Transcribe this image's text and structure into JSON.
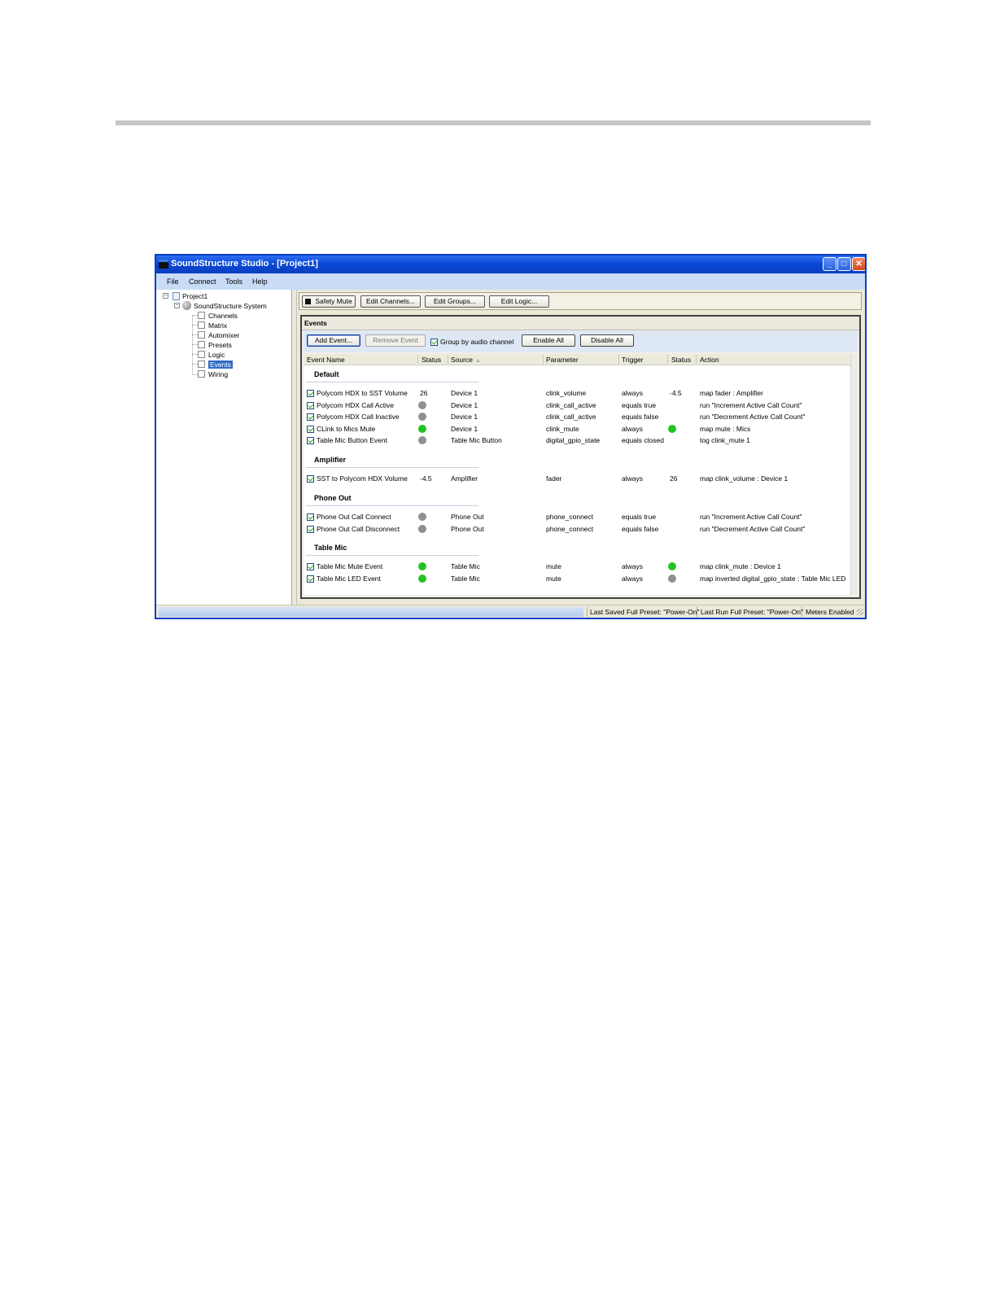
{
  "window": {
    "title": "SoundStructure Studio - [Project1]",
    "controls": {
      "minimize": "_",
      "maximize": "□",
      "close": "✕"
    }
  },
  "menu": [
    "File",
    "Connect",
    "Tools",
    "Help"
  ],
  "tree": {
    "project": "Project1",
    "system": "SoundStructure System",
    "items": [
      "Channels",
      "Matrix",
      "Automixer",
      "Presets",
      "Logic",
      "Events",
      "Wiring"
    ],
    "selected": "Events"
  },
  "toolbar": {
    "safety_mute": "Safety Mute",
    "edit_channels": "Edit Channels...",
    "edit_groups": "Edit Groups...",
    "edit_logic": "Edit Logic..."
  },
  "events": {
    "panel_title": "Events",
    "add_event": "Add Event...",
    "remove_event": "Remove Event",
    "group_by": "Group by audio channel",
    "group_by_checked": true,
    "enable_all": "Enable All",
    "disable_all": "Disable All",
    "columns": [
      "Event Name",
      "Status",
      "Source",
      "Parameter",
      "Trigger",
      "Status",
      "Action"
    ],
    "groups": [
      {
        "title": "Default",
        "rows": [
          {
            "name": "Polycom HDX to SST Volume",
            "status": "26",
            "source": "Device 1",
            "parameter": "clink_volume",
            "trigger": "always",
            "status2": "-4.5",
            "action": "map fader : Amplifier"
          },
          {
            "name": "Polycom HDX Call Active",
            "status": "gray",
            "source": "Device 1",
            "parameter": "clink_call_active",
            "trigger": "equals true",
            "status2": "",
            "action": "run \"Increment Active Call Count\""
          },
          {
            "name": "Polycom HDX Call Inactive",
            "status": "gray",
            "source": "Device 1",
            "parameter": "clink_call_active",
            "trigger": "equals false",
            "status2": "",
            "action": "run \"Decrement Active Call Count\""
          },
          {
            "name": "CLink to Mics Mute",
            "status": "green",
            "source": "Device 1",
            "parameter": "clink_mute",
            "trigger": "always",
            "status2": "green",
            "action": "map mute : Mics"
          },
          {
            "name": "Table Mic Button Event",
            "status": "gray",
            "source": "Table Mic Button",
            "parameter": "digital_gpio_state",
            "trigger": "equals closed",
            "status2": "",
            "action": "tog clink_mute 1"
          }
        ]
      },
      {
        "title": "Amplifier",
        "rows": [
          {
            "name": "SST to Polycom HDX Volume",
            "status": "-4.5",
            "source": "Amplifier",
            "parameter": "fader",
            "trigger": "always",
            "status2": "26",
            "action": "map clink_volume : Device 1"
          }
        ]
      },
      {
        "title": "Phone Out",
        "rows": [
          {
            "name": "Phone Out Call Connect",
            "status": "gray",
            "source": "Phone Out",
            "parameter": "phone_connect",
            "trigger": "equals true",
            "status2": "",
            "action": "run \"Increment Active Call Count\""
          },
          {
            "name": "Phone Out Call Disconnect",
            "status": "gray",
            "source": "Phone Out",
            "parameter": "phone_connect",
            "trigger": "equals false",
            "status2": "",
            "action": "run \"Decrement Active Call Count\""
          }
        ]
      },
      {
        "title": "Table Mic",
        "rows": [
          {
            "name": "Table Mic Mute Event",
            "status": "green",
            "source": "Table Mic",
            "parameter": "mute",
            "trigger": "always",
            "status2": "green",
            "action": "map clink_mute : Device 1"
          },
          {
            "name": "Table Mic LED Event",
            "status": "green",
            "source": "Table Mic",
            "parameter": "mute",
            "trigger": "always",
            "status2": "gray",
            "action": "map inverted digital_gpio_state : Table Mic LED"
          }
        ]
      }
    ]
  },
  "statusbar": {
    "last_saved": "Last Saved Full Preset: \"Power-On\"",
    "last_run": "Last Run Full Preset: \"Power-On\"",
    "meters": "Meters Enabled"
  },
  "colors": {
    "status_green": "#22c422",
    "status_gray": "#8f8f8f",
    "title_blue": "#0a49d6",
    "selection_blue": "#316ac5"
  }
}
